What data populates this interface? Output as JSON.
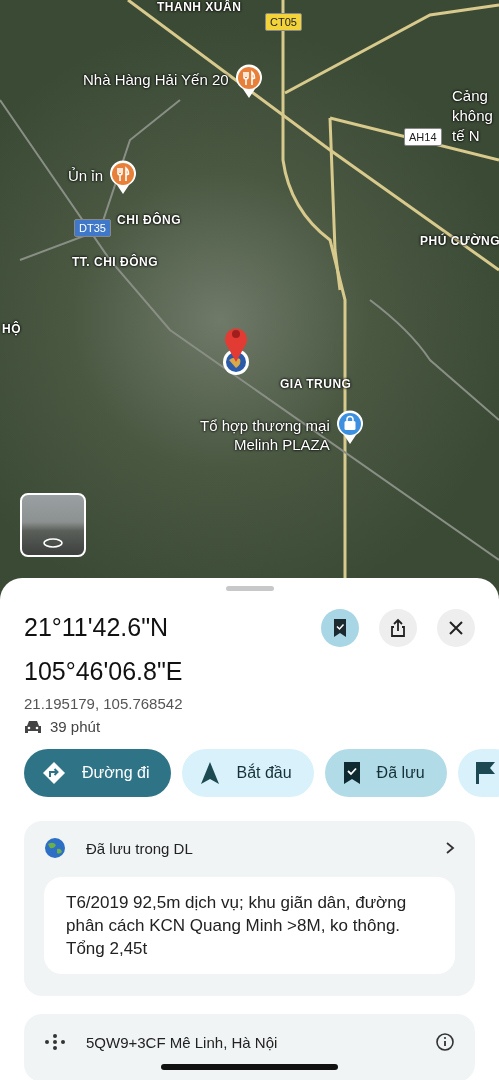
{
  "map": {
    "labels": [
      {
        "kind": "place",
        "lines": [
          "THANH XUÂN"
        ]
      },
      {
        "kind": "shield",
        "lines": [
          "CT05"
        ],
        "color": "#f2d33a"
      },
      {
        "kind": "restaurant_poi",
        "lines": [
          "Nhà Hàng Hải Yến 20"
        ],
        "color": "#e8803a"
      },
      {
        "kind": "shield",
        "lines": [
          "AH14"
        ],
        "color": "#ffffff"
      },
      {
        "kind": "poi_text",
        "lines": [
          "Cảng",
          "không",
          "tế N"
        ]
      },
      {
        "kind": "restaurant_poi",
        "lines": [
          "Ủn ỉn"
        ],
        "color": "#e8803a"
      },
      {
        "kind": "shield",
        "lines": [
          "DT35"
        ],
        "color": "#3f78c8"
      },
      {
        "kind": "place",
        "lines": [
          "CHI ĐÔNG"
        ]
      },
      {
        "kind": "place",
        "lines": [
          "PHÚ CƯỜNG"
        ]
      },
      {
        "kind": "place",
        "lines": [
          "TT. CHI ĐÔNG"
        ]
      },
      {
        "kind": "place",
        "lines": [
          "HỘ"
        ]
      },
      {
        "kind": "place",
        "lines": [
          "GIA TRUNG"
        ]
      },
      {
        "kind": "shopping_poi",
        "lines": [
          "Tổ hợp thương mại",
          "Melinh PLAZA"
        ],
        "color": "#3d8fe0"
      }
    ]
  },
  "sheet": {
    "title": "21°11'42.6\"N 105°46'06.8\"E",
    "header_buttons": [
      {
        "kind": "save",
        "on": true
      },
      {
        "kind": "share",
        "on": false
      },
      {
        "kind": "close",
        "on": false
      }
    ],
    "coordinates": "21.195179, 105.768542",
    "travel_time": "39 phút",
    "chips": [
      {
        "kind": "directions",
        "label": "Đường đi",
        "primary": true,
        "on": false
      },
      {
        "kind": "start",
        "label": "Bắt đầu",
        "primary": false,
        "on": false
      },
      {
        "kind": "saved",
        "label": "Đã lưu",
        "primary": false,
        "on": true
      },
      {
        "kind": "flag",
        "primary": false,
        "on": false
      }
    ],
    "saved_list": {
      "name": "Đã lưu trong DL",
      "note": "T6/2019 92,5m dịch vụ; khu giãn dân, đường phân cách KCN Quang Minh >8M, ko thông. Tổng 2,45t"
    },
    "address": {
      "plus_code": "5QW9+3CF Mê Linh, Hà Nội"
    }
  }
}
